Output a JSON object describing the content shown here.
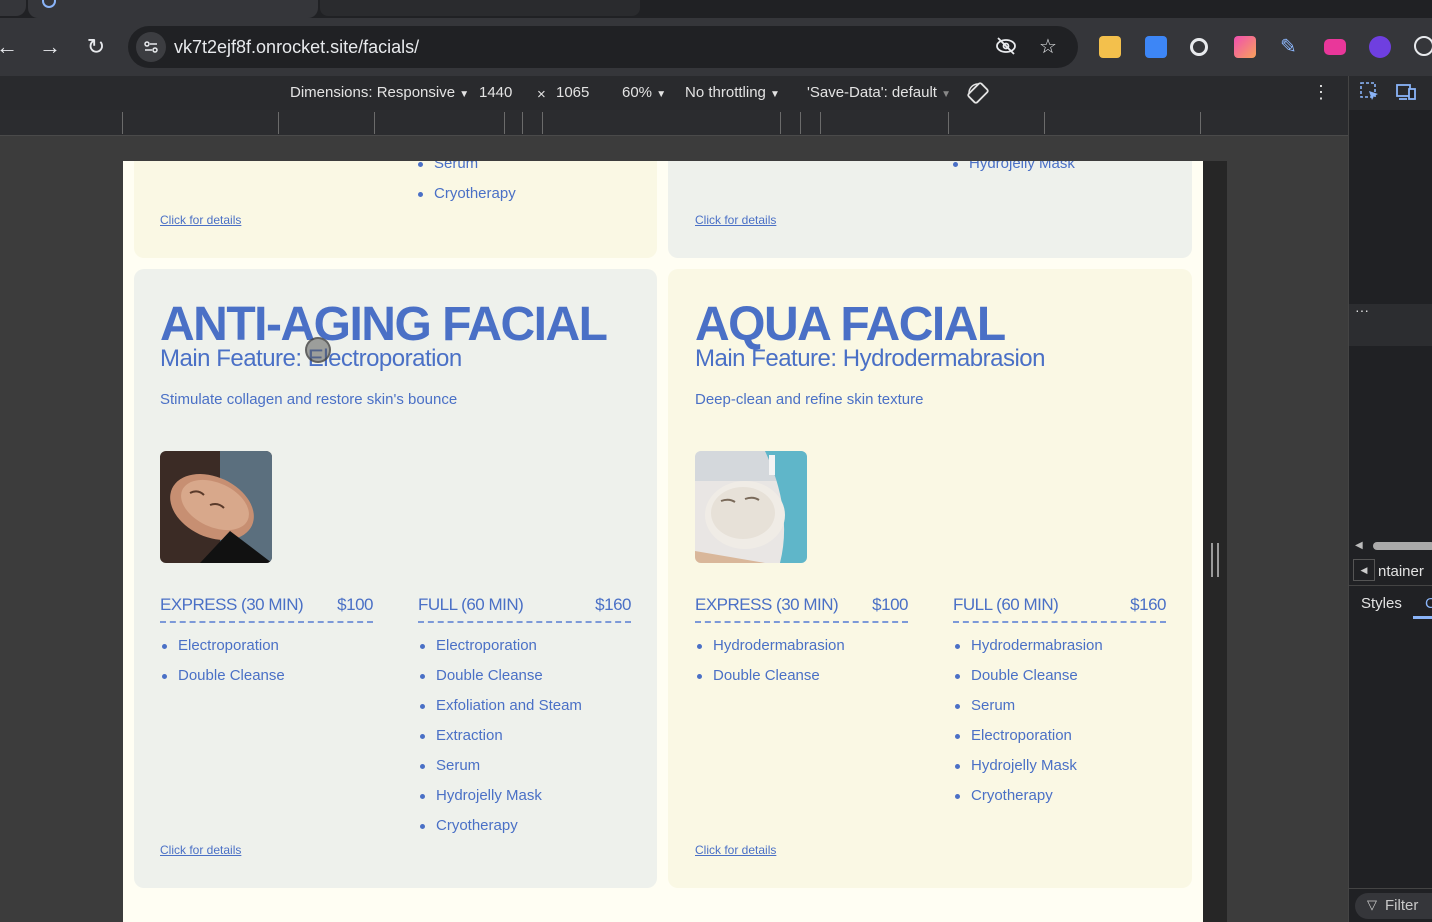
{
  "browser": {
    "url": "vk7t2ejf8f.onrocket.site/facials/",
    "nav": {
      "back": "←",
      "forward": "→",
      "reload": "↻"
    },
    "omnibox_icons": [
      "eye-off-icon",
      "star-icon"
    ]
  },
  "device_toolbar": {
    "dimensions_label": "Dimensions: Responsive",
    "width": "1440",
    "times": "×",
    "height": "1065",
    "zoom": "60%",
    "throttling": "No throttling",
    "save_data": "'Save-Data': default",
    "caret": "▼"
  },
  "devtools": {
    "ellipsis": "···",
    "breadcrumb": "ntainer",
    "styles_tab": "Styles",
    "filter": "Filter",
    "next_tab_initial": "C"
  },
  "page": {
    "top_left_card": {
      "items": [
        "Serum",
        "Cryotherapy"
      ],
      "details": "Click for details"
    },
    "top_right_card": {
      "items": [
        "Hydrojelly Mask"
      ],
      "details": "Click for details"
    },
    "cards": [
      {
        "title": "ANTI-AGING FACIAL",
        "feature": "Main Feature: Electroporation",
        "description": "Stimulate collagen and restore skin's bounce",
        "express": {
          "name": "EXPRESS (30 MIN)",
          "price": "$100",
          "items": [
            "Electroporation",
            "Double Cleanse"
          ]
        },
        "full": {
          "name": "FULL (60 MIN)",
          "price": "$160",
          "items": [
            "Electroporation",
            "Double Cleanse",
            "Exfoliation and Steam",
            "Extraction",
            "Serum",
            "Hydrojelly Mask",
            "Cryotherapy"
          ]
        },
        "details": "Click for details"
      },
      {
        "title": "AQUA FACIAL",
        "feature": "Main Feature: Hydrodermabrasion",
        "description": "Deep-clean and refine skin texture",
        "express": {
          "name": "EXPRESS (30 MIN)",
          "price": "$100",
          "items": [
            "Hydrodermabrasion",
            "Double Cleanse"
          ]
        },
        "full": {
          "name": "FULL (60 MIN)",
          "price": "$160",
          "items": [
            "Hydrodermabrasion",
            "Double Cleanse",
            "Serum",
            "Electroporation",
            "Hydrojelly Mask",
            "Cryotherapy"
          ]
        },
        "details": "Click for details"
      }
    ]
  },
  "colors": {
    "brand_blue": "#4a70c6",
    "card_blue": "#eef1ec",
    "card_cream": "#faf8e4",
    "page_bg": "#fffef3"
  }
}
